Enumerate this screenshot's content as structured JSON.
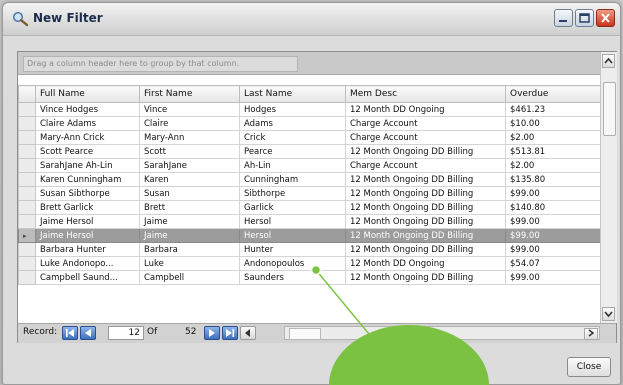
{
  "window": {
    "title": "New Filter",
    "controls": {
      "minimize": "minimize",
      "maximize": "maximize",
      "close": "close"
    }
  },
  "grid": {
    "group_hint": "Drag a column header here to group by that column.",
    "columns": [
      "Full Name",
      "First Name",
      "Last Name",
      "Mem Desc",
      "Overdue"
    ],
    "rows": [
      [
        "Vince Hodges",
        "Vince",
        "Hodges",
        "12 Month DD Ongoing",
        "$461.23"
      ],
      [
        "Claire Adams",
        "Claire",
        "Adams",
        "Charge Account",
        "$10.00"
      ],
      [
        "Mary-Ann Crick",
        "Mary-Ann",
        "Crick",
        "Charge Account",
        "$2.00"
      ],
      [
        "Scott Pearce",
        "Scott",
        "Pearce",
        "12 Month Ongoing DD Billing",
        "$513.81"
      ],
      [
        "SarahJane Ah-Lin",
        "SarahJane",
        "Ah-Lin",
        "Charge Account",
        "$2.00"
      ],
      [
        "Karen Cunningham",
        "Karen",
        "Cunningham",
        "12 Month Ongoing DD Billing",
        "$135.80"
      ],
      [
        "Susan Sibthorpe",
        "Susan",
        "Sibthorpe",
        "12 Month Ongoing DD Billing",
        "$99.00"
      ],
      [
        "Brett Garlick",
        "Brett",
        "Garlick",
        "12 Month Ongoing DD Billing",
        "$140.80"
      ],
      [
        "Jaime Hersol",
        "Jaime",
        "Hersol",
        "12 Month Ongoing DD Billing",
        "$99.00"
      ],
      [
        "Jaime Hersol",
        "Jaime",
        "Hersol",
        "12 Month Ongoing DD Billing",
        "$99.00"
      ],
      [
        "Barbara Hunter",
        "Barbara",
        "Hunter",
        "12 Month Ongoing DD Billing",
        "$99.00"
      ],
      [
        "Luke Andonopo...",
        "Luke",
        "Andonopoulos",
        "12 Month DD Ongoing",
        "$54.07"
      ],
      [
        "Campbell Saund...",
        "Campbell",
        "Saunders",
        "12 Month Ongoing DD Billing",
        "$99.00"
      ]
    ],
    "current_row_index": 9
  },
  "navigator": {
    "label": "Record:",
    "current": "12",
    "of": "Of",
    "total": "52"
  },
  "footer": {
    "close_label": "Close"
  },
  "colors": {
    "callout_green": "#7cc242",
    "selected_row": "#9c9c9c",
    "nav_button": "#3d6fc0"
  }
}
